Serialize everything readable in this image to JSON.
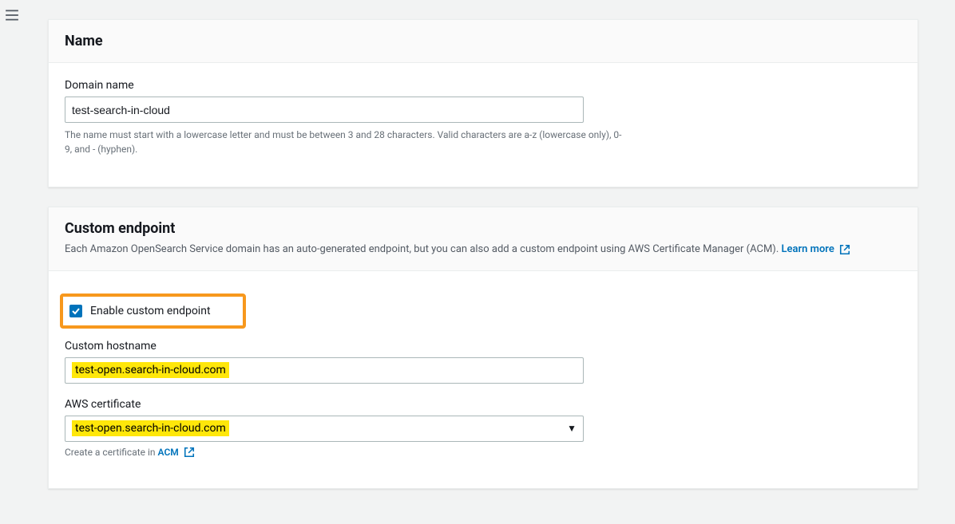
{
  "name_section": {
    "title": "Name",
    "domain_name_label": "Domain name",
    "domain_name_value": "test-search-in-cloud",
    "help_text": "The name must start with a lowercase letter and must be between 3 and 28 characters. Valid characters are a-z (lowercase only), 0-9, and - (hyphen)."
  },
  "endpoint_section": {
    "title": "Custom endpoint",
    "description": "Each Amazon OpenSearch Service domain has an auto-generated endpoint, but you can also add a custom endpoint using AWS Certificate Manager (ACM). ",
    "learn_more": "Learn more",
    "enable_checkbox_label": "Enable custom endpoint",
    "enable_checkbox_checked": true,
    "hostname_label": "Custom hostname",
    "hostname_value": "test-open.search-in-cloud.com",
    "certificate_label": "AWS certificate",
    "certificate_value": "test-open.search-in-cloud.com",
    "acm_prefix": "Create a certificate in ",
    "acm_link": "ACM"
  }
}
